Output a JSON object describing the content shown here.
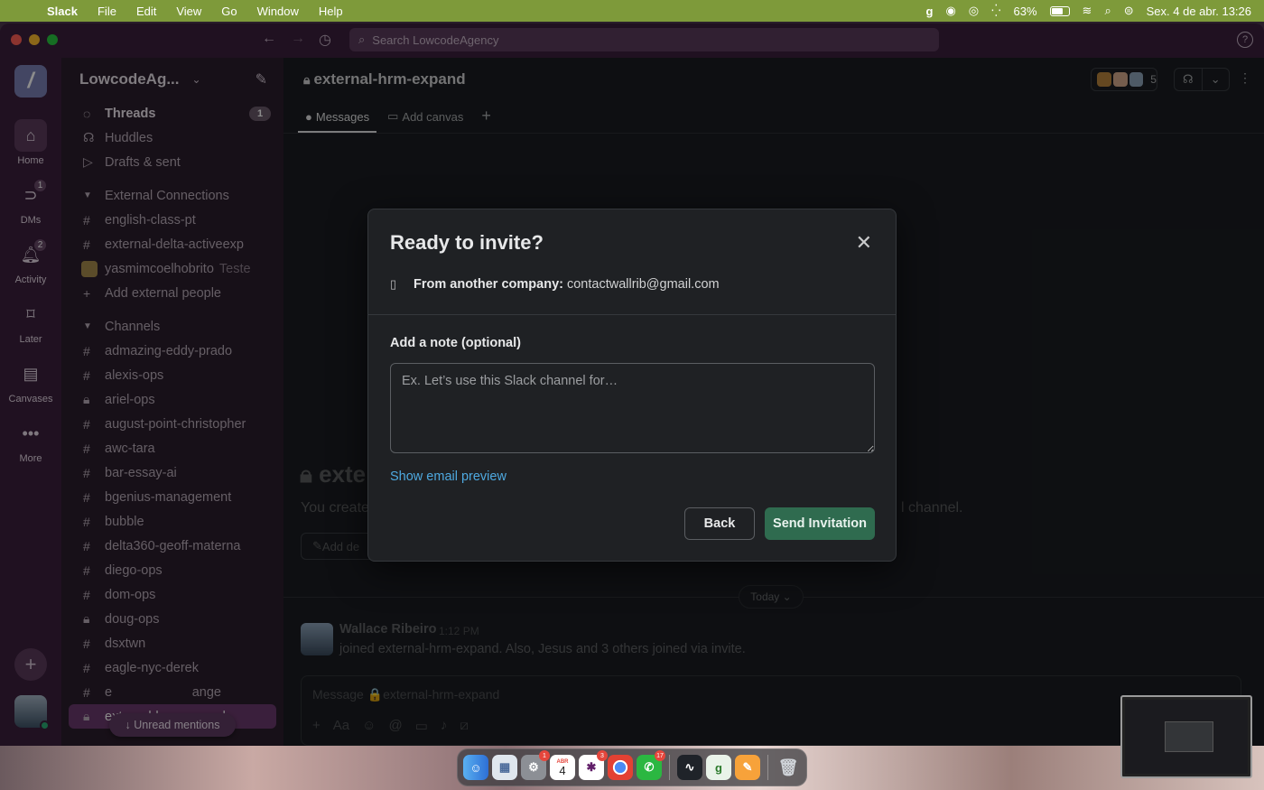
{
  "menubar": {
    "app_name": "Slack",
    "menus": [
      "File",
      "Edit",
      "View",
      "Go",
      "Window",
      "Help"
    ],
    "battery": "63%",
    "datetime": "Sex. 4 de abr.  13:26"
  },
  "titlebar": {
    "search_placeholder": "Search LowcodeAgency"
  },
  "rail": {
    "logo_letter": "/",
    "items": [
      {
        "label": "Home",
        "icon": "home-icon"
      },
      {
        "label": "DMs",
        "icon": "dms-icon",
        "badge": "1"
      },
      {
        "label": "Activity",
        "icon": "bell-icon",
        "badge": "2"
      },
      {
        "label": "Later",
        "icon": "bookmark-icon"
      },
      {
        "label": "Canvases",
        "icon": "canvas-icon"
      },
      {
        "label": "More",
        "icon": "more-icon"
      }
    ]
  },
  "sidebar": {
    "workspace": "LowcodeAg...",
    "top_items": [
      {
        "label": "Threads",
        "count": "1"
      },
      {
        "label": "Huddles"
      },
      {
        "label": "Drafts & sent"
      }
    ],
    "external_section": "External Connections",
    "external_items": [
      "english-class-pt",
      "external-delta-activeexp"
    ],
    "external_person": "yasmimcoelhobrito",
    "external_person_note": "Teste",
    "add_external": "Add external people",
    "channels_section": "Channels",
    "channels": [
      {
        "name": "admazing-eddy-prado",
        "private": false
      },
      {
        "name": "alexis-ops",
        "private": false
      },
      {
        "name": "ariel-ops",
        "private": true
      },
      {
        "name": "august-point-christopher",
        "private": false
      },
      {
        "name": "awc-tara",
        "private": false
      },
      {
        "name": "bar-essay-ai",
        "private": false
      },
      {
        "name": "bgenius-management",
        "private": false
      },
      {
        "name": "bubble",
        "private": false
      },
      {
        "name": "delta360-geoff-materna",
        "private": false
      },
      {
        "name": "diego-ops",
        "private": false
      },
      {
        "name": "dom-ops",
        "private": false
      },
      {
        "name": "doug-ops",
        "private": true
      },
      {
        "name": "dsxtwn",
        "private": false
      },
      {
        "name": "eagle-nyc-derek",
        "private": false
      },
      {
        "name": "e                      ange",
        "private": false
      },
      {
        "name": "external-hrm-expand",
        "private": true
      }
    ],
    "unread_pill": "↓ Unread mentions"
  },
  "channel": {
    "name": "external-hrm-expand",
    "member_count": "5",
    "tabs": [
      "Messages",
      "Add canvas"
    ],
    "intro_title": "exte",
    "intro_text_left": "You create",
    "intro_text_right": "l channel.",
    "add_description": "Add de",
    "today": "Today",
    "message": {
      "author": "Wallace Ribeiro",
      "time": "1:12 PM",
      "text": "joined external-hrm-expand. Also, Jesus and 3 others joined via invite."
    },
    "composer_placeholder": "Message 🔒external-hrm-expand"
  },
  "modal": {
    "title": "Ready to invite?",
    "from_label": "From another company:",
    "from_email": "contactwallrib@gmail.com",
    "note_label": "Add a note (optional)",
    "note_placeholder": "Ex. Let’s use this Slack channel for…",
    "email_preview_link": "Show email preview",
    "back_button": "Back",
    "send_button": "Send Invitation"
  },
  "dock": {
    "calendar_month": "ABR",
    "calendar_day": "4"
  },
  "colors": {
    "menubar": "#7e9a3a",
    "aubergine": "#3b1f3c",
    "send_button": "#2f6b4f",
    "link": "#4ea9e0"
  }
}
